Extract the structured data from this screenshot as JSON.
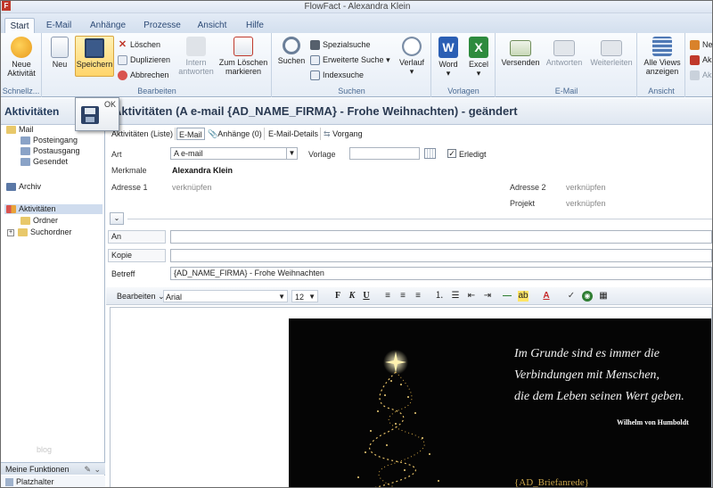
{
  "window": {
    "title": "FlowFact - Alexandra Klein",
    "app_icon": "F"
  },
  "tabs": [
    "Start",
    "E-Mail",
    "Anhänge",
    "Prozesse",
    "Ansicht",
    "Hilfe"
  ],
  "ribbon": {
    "schnellzugriff": {
      "label": "Schnellz...",
      "new_activity": "Neue Aktivität"
    },
    "bearbeiten": {
      "label": "Bearbeiten",
      "neu": "Neu",
      "speichern": "Speichern",
      "loeschen": "Löschen",
      "duplizieren": "Duplizieren",
      "abbrechen": "Abbrechen",
      "intern": "Intern antworten",
      "zum_loeschen": "Zum Löschen markieren"
    },
    "suchen": {
      "label": "Suchen",
      "suchen": "Suchen",
      "spezialsuche": "Spezialsuche",
      "erweiterte": "Erweiterte Suche",
      "indexsuche": "Indexsuche",
      "verlauf": "Verlauf"
    },
    "vorlagen": {
      "label": "Vorlagen",
      "word": "Word",
      "excel": "Excel"
    },
    "email": {
      "label": "E-Mail",
      "versenden": "Versenden",
      "antworten": "Antworten",
      "weiterleiten": "Weiterleiten"
    },
    "ansicht": {
      "label": "Ansicht",
      "alle_views": "Alle Views anzeigen"
    },
    "extra": {
      "ne": "Ne",
      "ak1": "Ak",
      "ak2": "Ak"
    }
  },
  "sidebar": {
    "title": "Aktivitäten",
    "items": [
      {
        "label": "Mail"
      },
      {
        "label": "Posteingang"
      },
      {
        "label": "Postausgang"
      },
      {
        "label": "Gesendet"
      },
      {
        "label": "Archiv"
      },
      {
        "label": "Aktivitäten"
      },
      {
        "label": "Ordner"
      },
      {
        "label": "Suchordner"
      }
    ],
    "watermark": "blog",
    "meine_funktionen": "Meine Funktionen",
    "platzhalter": "Platzhalter"
  },
  "popup": {
    "ok": "OK"
  },
  "main": {
    "title": "Aktivitäten (A e-mail {AD_NAME_FIRMA} - Frohe Weihnachten) - geändert",
    "subtabs": [
      "Aktivitäten (Liste)",
      "E-Mail",
      "Anhänge (0)",
      "E-Mail-Details",
      "Vorgang"
    ],
    "art_label": "Art",
    "art_value": "A e-mail",
    "vorlage_label": "Vorlage",
    "vorlage_value": "",
    "erledigt_label": "Erledigt",
    "erledigt_checked": true,
    "merkmale_label": "Merkmale",
    "merkmale_value": "Alexandra Klein",
    "adresse1_label": "Adresse 1",
    "adresse1_value": "verknüpfen",
    "adresse2_label": "Adresse 2",
    "adresse2_value": "verknüpfen",
    "projekt_label": "Projekt",
    "projekt_value": "verknüpfen",
    "an_label": "An",
    "kopie_label": "Kopie",
    "betreff_label": "Betreff",
    "betreff_value": "{AD_NAME_FIRMA} - Frohe Weihnachten"
  },
  "editor": {
    "bearbeiten": "Bearbeiten",
    "font": "Arial",
    "size": "12",
    "quote_lines": [
      "Im Grunde sind es immer die",
      "Verbindungen mit Menschen,",
      "die dem Leben seinen Wert geben."
    ],
    "author": "Wilhelm von Humboldt",
    "placeholder": "{AD_Briefanrede}"
  }
}
